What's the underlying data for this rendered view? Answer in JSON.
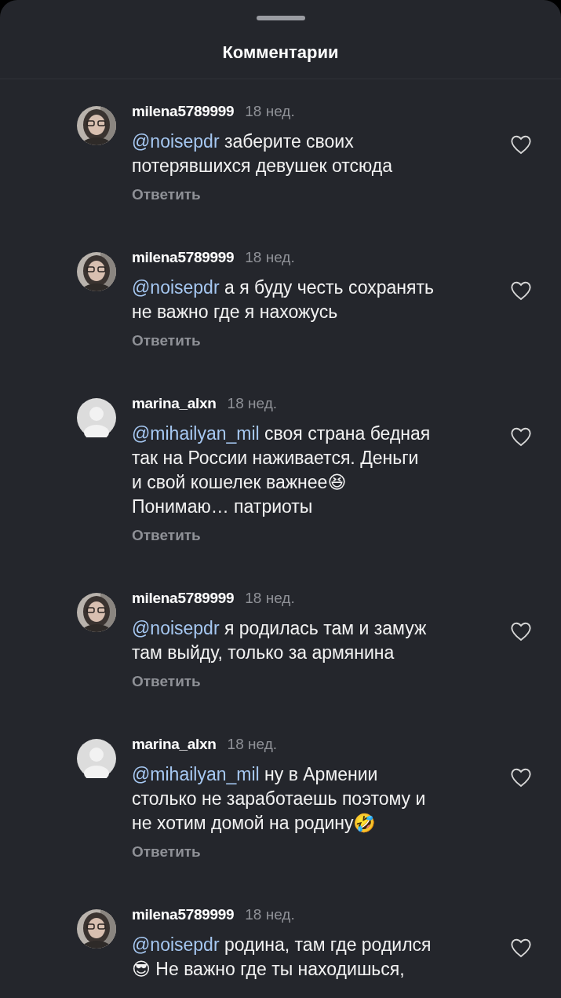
{
  "title": "Комментарии",
  "comments": [
    {
      "author": "milena5789999",
      "time": "18 нед.",
      "mention": "@noisepdr",
      "text": "заберите своих\nпотерявшихся девушек отсюда",
      "reply": "Ответить",
      "liked": false
    },
    {
      "author": "milena5789999",
      "time": "18 нед.",
      "mention": "@noisepdr",
      "text": "а я буду честь сохранять\nне важно где я нахожусь",
      "reply": "Ответить",
      "liked": false
    },
    {
      "author": "marina_alxn",
      "time": "18 нед.",
      "avatar": {
        "kind": "default"
      },
      "mention": "@mihailyan_mil",
      "text": "своя страна бедная\nтак на России наживается. Деньги\nи свой кошелек важнее😆\nПонимаю… патриоты",
      "reply": "Ответить",
      "liked": false
    },
    {
      "author": "milena5789999",
      "time": "18 нед.",
      "mention": "@noisepdr",
      "text": "я родилась там и замуж\nтам выйду, только за армянина",
      "reply": "Ответить",
      "liked": false
    },
    {
      "author": "marina_alxn",
      "time": "18 нед.",
      "avatar": {
        "kind": "default"
      },
      "mention": "@mihailyan_mil",
      "text": "ну в Армении\nстолько не заработаешь поэтому и\nне хотим домой на родину🤣",
      "reply": "Ответить",
      "liked": false
    },
    {
      "author": "milena5789999",
      "time": "18 нед.",
      "mention": "@noisepdr",
      "text": "родина, там где родился\n😎 Не важно где ты находишься,",
      "liked": false
    }
  ]
}
